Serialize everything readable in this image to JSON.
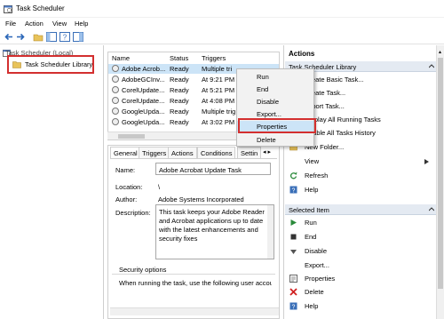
{
  "window": {
    "title": "Task Scheduler"
  },
  "menu": [
    "File",
    "Action",
    "View",
    "Help"
  ],
  "tree": {
    "root": "Task Scheduler (Local)",
    "library": "Task Scheduler Library"
  },
  "task_list": {
    "columns": [
      "Name",
      "Status",
      "Triggers"
    ],
    "rows": [
      {
        "name": "Adobe Acrob...",
        "status": "Ready",
        "triggers": "Multiple tri"
      },
      {
        "name": "AdobeGCInv...",
        "status": "Ready",
        "triggers": "At 9:21 PM e"
      },
      {
        "name": "CorelUpdate...",
        "status": "Ready",
        "triggers": "At 5:21 PM e"
      },
      {
        "name": "CorelUpdate...",
        "status": "Ready",
        "triggers": "At 4:08 PM e"
      },
      {
        "name": "GoogleUpda...",
        "status": "Ready",
        "triggers": "Multiple trig"
      },
      {
        "name": "GoogleUpda...",
        "status": "Ready",
        "triggers": "At 3:02 PM e"
      }
    ]
  },
  "context_menu": [
    "Run",
    "End",
    "Disable",
    "Export...",
    "Properties",
    "Delete"
  ],
  "details": {
    "tabs": [
      "General",
      "Triggers",
      "Actions",
      "Conditions",
      "Settin"
    ],
    "name_label": "Name:",
    "name_value": "Adobe Acrobat Update Task",
    "location_label": "Location:",
    "location_value": "\\",
    "author_label": "Author:",
    "author_value": "Adobe Systems Incorporated",
    "description_label": "Description:",
    "description_value": "This task keeps your Adobe Reader and Acrobat applications up to date with the latest enhancements and security fixes",
    "security_header": "Security options",
    "security_text": "When running the task, use the following user account:"
  },
  "actions": {
    "header": "Actions",
    "section1_title": "Task Scheduler Library",
    "section1_items": [
      "Create Basic Task...",
      "Create Task...",
      "Import Task...",
      "Display All Running Tasks",
      "Enable All Tasks History",
      "New Folder...",
      "View",
      "Refresh",
      "Help"
    ],
    "section2_title": "Selected Item",
    "section2_items": [
      "Run",
      "End",
      "Disable",
      "Export...",
      "Properties",
      "Delete",
      "Help"
    ]
  },
  "colors": {
    "highlight_red": "#d32f2f",
    "selection_blue": "#cce4f7"
  }
}
